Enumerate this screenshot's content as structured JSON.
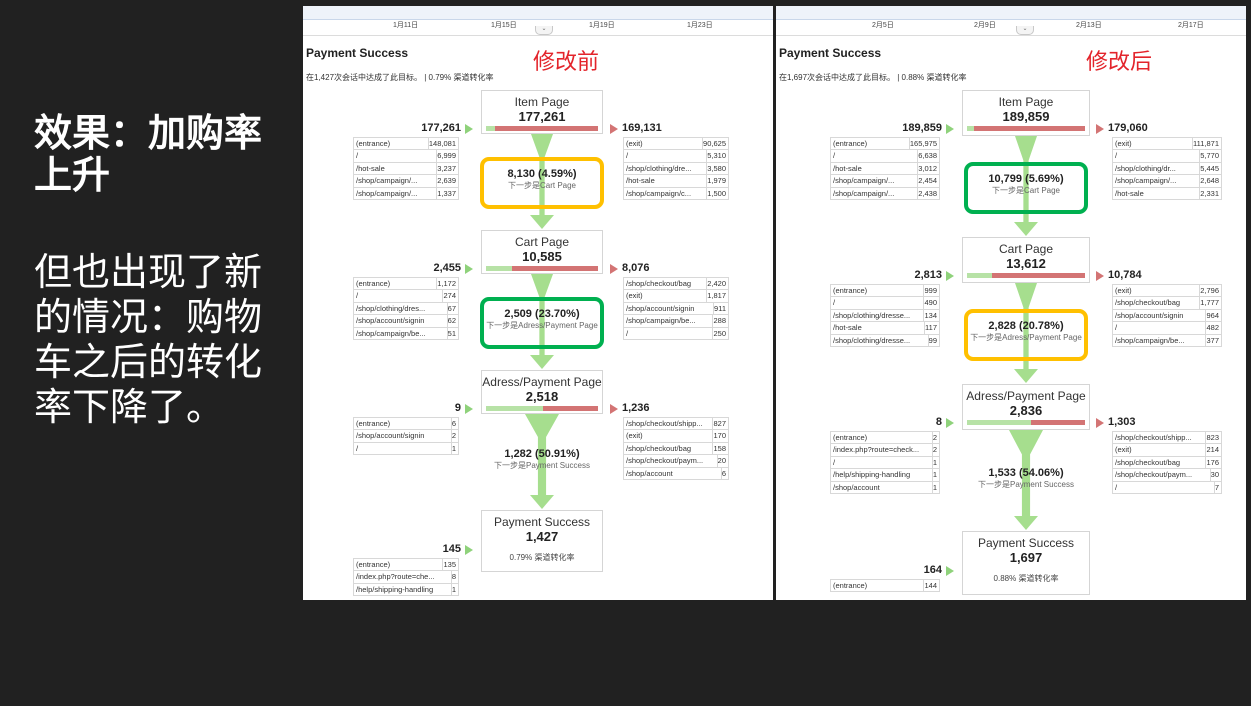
{
  "headline": [
    "效果：加购率",
    "上升"
  ],
  "body": [
    "但也出现了新",
    "的情况：购物",
    "车之后的转化",
    "率下降了。"
  ],
  "colors": {
    "highlight_orange": "#ffc000",
    "highlight_green": "#00b050",
    "overlay_red": "#e3242b",
    "bar_green": "#b7e2a6",
    "bar_red": "#d37474"
  },
  "left": {
    "overlay": "修改前",
    "timeline": [
      "1月11日",
      "1月15日",
      "1月19日",
      "1月23日"
    ],
    "goal_title": "Payment Success",
    "goal_sub": "在1,427次会话中达成了此目标。 | 0.79% 渠道转化率",
    "steps": [
      {
        "name": "Item Page",
        "value": "177,261",
        "in": "177,261",
        "out": "169,131",
        "in_fraction": 0.08,
        "in_rows": [
          [
            "(entrance)",
            "148,081"
          ],
          [
            "/",
            "6,999"
          ],
          [
            "/hot-sale",
            "3,237"
          ],
          [
            "/shop/campaign/...",
            "2,639"
          ],
          [
            "/shop/campaign/...",
            "1,337"
          ]
        ],
        "out_rows": [
          [
            "(exit)",
            "90,625"
          ],
          [
            "/",
            "5,310"
          ],
          [
            "/shop/clothing/dre...",
            "3,580"
          ],
          [
            "/hot-sale",
            "1,979"
          ],
          [
            "/shop/campaign/c...",
            "1,500"
          ]
        ],
        "conv": "8,130 (4.59%)",
        "conv_label": "下一步是Cart Page",
        "highlight": "orange"
      },
      {
        "name": "Cart Page",
        "value": "10,585",
        "in": "2,455",
        "out": "8,076",
        "in_fraction": 0.23,
        "in_rows": [
          [
            "(entrance)",
            "1,172"
          ],
          [
            "/",
            "274"
          ],
          [
            "/shop/clothing/dres...",
            "67"
          ],
          [
            "/shop/account/signin",
            "62"
          ],
          [
            "/shop/campaign/be...",
            "51"
          ]
        ],
        "out_rows": [
          [
            "/shop/checkout/bag",
            "2,420"
          ],
          [
            "(exit)",
            "1,817"
          ],
          [
            "/shop/account/signin",
            "911"
          ],
          [
            "/shop/campaign/be...",
            "288"
          ],
          [
            "/",
            "250"
          ]
        ],
        "conv": "2,509 (23.70%)",
        "conv_label": "下一步是Adress/Payment Page",
        "highlight": "green"
      },
      {
        "name": "Adress/Payment Page",
        "value": "2,518",
        "in": "9",
        "out": "1,236",
        "in_fraction": 0.51,
        "in_rows": [
          [
            "(entrance)",
            "6"
          ],
          [
            "/shop/account/signin",
            "2"
          ],
          [
            "/",
            "1"
          ]
        ],
        "out_rows": [
          [
            "/shop/checkout/shipp...",
            "827"
          ],
          [
            "(exit)",
            "170"
          ],
          [
            "/shop/checkout/bag",
            "158"
          ],
          [
            "/shop/checkout/paym...",
            "20"
          ],
          [
            "/shop/account",
            "6"
          ]
        ],
        "conv": "1,282 (50.91%)",
        "conv_label": "下一步是Payment Success",
        "highlight": ""
      },
      {
        "name": "Payment Success",
        "value": "1,427",
        "in": "145",
        "rate": "0.79% 渠道转化率",
        "in_rows": [
          [
            "(entrance)",
            "135"
          ],
          [
            "/index.php?route=che...",
            "8"
          ],
          [
            "/help/shipping-handling",
            "1"
          ]
        ]
      }
    ]
  },
  "right": {
    "overlay": "修改后",
    "timeline": [
      "2月5日",
      "2月9日",
      "2月13日",
      "2月17日"
    ],
    "goal_title": "Payment Success",
    "goal_sub": "在1,697次会话中达成了此目标。 | 0.88% 渠道转化率",
    "steps": [
      {
        "name": "Item Page",
        "value": "189,859",
        "in": "189,859",
        "out": "179,060",
        "in_fraction": 0.06,
        "in_rows": [
          [
            "(entrance)",
            "165,975"
          ],
          [
            "/",
            "6,638"
          ],
          [
            "/hot-sale",
            "3,012"
          ],
          [
            "/shop/campaign/...",
            "2,454"
          ],
          [
            "/shop/campaign/...",
            "2,438"
          ]
        ],
        "out_rows": [
          [
            "(exit)",
            "111,871"
          ],
          [
            "/",
            "5,770"
          ],
          [
            "/shop/clothing/dr...",
            "5,445"
          ],
          [
            "/shop/campaign/...",
            "2,648"
          ],
          [
            "/hot-sale",
            "2,331"
          ]
        ],
        "conv": "10,799 (5.69%)",
        "conv_label": "下一步是Cart Page",
        "highlight": "green"
      },
      {
        "name": "Cart Page",
        "value": "13,612",
        "in": "2,813",
        "out": "10,784",
        "in_fraction": 0.21,
        "in_rows": [
          [
            "(entrance)",
            "999"
          ],
          [
            "/",
            "490"
          ],
          [
            "/shop/clothing/dresse...",
            "134"
          ],
          [
            "/hot-sale",
            "117"
          ],
          [
            "/shop/clothing/dresse...",
            "99"
          ]
        ],
        "out_rows": [
          [
            "(exit)",
            "2,796"
          ],
          [
            "/shop/checkout/bag",
            "1,777"
          ],
          [
            "/shop/account/signin",
            "964"
          ],
          [
            "/",
            "482"
          ],
          [
            "/shop/campaign/be...",
            "377"
          ]
        ],
        "conv": "2,828 (20.78%)",
        "conv_label": "下一步是Adress/Payment Page",
        "highlight": "orange"
      },
      {
        "name": "Adress/Payment Page",
        "value": "2,836",
        "in": "8",
        "out": "1,303",
        "in_fraction": 0.54,
        "in_rows": [
          [
            "(entrance)",
            "2"
          ],
          [
            "/index.php?route=check...",
            "2"
          ],
          [
            "/",
            "1"
          ],
          [
            "/help/shipping-handling",
            "1"
          ],
          [
            "/shop/account",
            "1"
          ]
        ],
        "out_rows": [
          [
            "/shop/checkout/shipp...",
            "823"
          ],
          [
            "(exit)",
            "214"
          ],
          [
            "/shop/checkout/bag",
            "176"
          ],
          [
            "/shop/checkout/paym...",
            "30"
          ],
          [
            "/",
            "7"
          ]
        ],
        "conv": "1,533 (54.06%)",
        "conv_label": "下一步是Payment Success",
        "highlight": ""
      },
      {
        "name": "Payment Success",
        "value": "1,697",
        "in": "164",
        "rate": "0.88% 渠道转化率",
        "in_rows": [
          [
            "(entrance)",
            "144"
          ]
        ]
      }
    ]
  }
}
